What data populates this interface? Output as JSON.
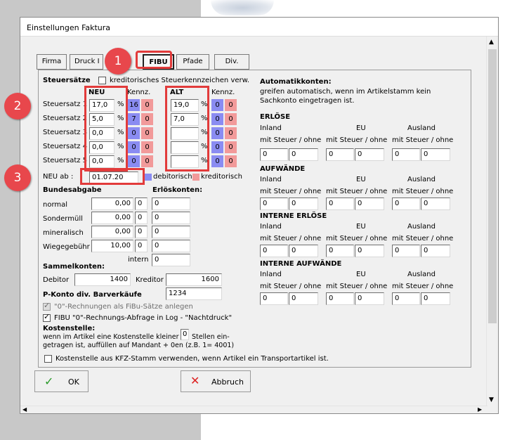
{
  "window": {
    "title": "Einstellungen Faktura"
  },
  "tabs": [
    {
      "label": "Firma",
      "active": false
    },
    {
      "label": "Druck I",
      "active": false
    },
    {
      "label": "FIBU",
      "active": true
    },
    {
      "label": "Pfade",
      "active": false
    },
    {
      "label": "Div.",
      "active": false
    }
  ],
  "annotations": {
    "badge1": "1",
    "badge2": "2",
    "badge3": "3",
    "color": "#e8474c"
  },
  "steuer": {
    "title": "Steuersätze",
    "kred_check_label": "kreditorisches Steuerkennzeichen verw.",
    "neu_header": "NEU",
    "alt_header": "ALT",
    "kennz_header": "Kennz.",
    "percent": "%",
    "rows": [
      {
        "label": "Steuersatz 1",
        "neu": "17,0",
        "neu_k1": "16",
        "neu_k2": "0",
        "alt": "19,0",
        "alt_k1": "0",
        "alt_k2": "0"
      },
      {
        "label": "Steuersatz 2",
        "neu": "5,0",
        "neu_k1": "7",
        "neu_k2": "0",
        "alt": "7,0",
        "alt_k1": "0",
        "alt_k2": "0"
      },
      {
        "label": "Steuersatz 3",
        "neu": "0,0",
        "neu_k1": "0",
        "neu_k2": "0",
        "alt": "",
        "alt_k1": "0",
        "alt_k2": "0"
      },
      {
        "label": "Steuersatz 4",
        "neu": "0,0",
        "neu_k1": "0",
        "neu_k2": "0",
        "alt": "",
        "alt_k1": "0",
        "alt_k2": "0"
      },
      {
        "label": "Steuersatz 5",
        "neu": "0,0",
        "neu_k1": "0",
        "neu_k2": "0",
        "alt": "",
        "alt_k1": "0",
        "alt_k2": "0"
      }
    ],
    "neu_ab_label": "NEU ab :",
    "neu_ab_value": "01.07.20",
    "legend_deb": "debitorisch",
    "legend_kred": "kreditorisch",
    "color_deb": "#8a8cf2",
    "color_kred": "#f29a9a"
  },
  "bundes": {
    "title": "Bundesabgabe",
    "erloes_title": "Erlöskonten:",
    "rows": [
      {
        "label": "normal",
        "value": "0,00",
        "k": "0",
        "konto": "0"
      },
      {
        "label": "Sondermüll",
        "value": "0,00",
        "k": "0",
        "konto": "0"
      },
      {
        "label": "mineralisch",
        "value": "0,00",
        "k": "0",
        "konto": "0"
      },
      {
        "label": "Wiegegebühr",
        "value": "10,00",
        "k": "0",
        "konto": "0"
      }
    ],
    "intern_label": "intern",
    "intern_value": "0"
  },
  "sammel": {
    "title": "Sammelkonten:",
    "debitor_label": "Debitor",
    "debitor_value": "1400",
    "kreditor_label": "Kreditor",
    "kreditor_value": "1600"
  },
  "pkonto": {
    "label": "P-Konto div. Barverkäufe",
    "value": "1234"
  },
  "checks": {
    "null_rech": "\"0\"-Rechnungen als FiBu-Sätze anlegen",
    "fibu_null": "FIBU \"0\"-Rechnungs-Abfrage in Log - \"Nachtdruck\"",
    "fibu_null_checked": true
  },
  "kst": {
    "title": "Kostenstelle:",
    "text1": "wenn im Artikel eine Kostenstelle kleiner",
    "value": "0",
    "text2": "Stellen ein-",
    "text3": "getragen ist, auffüllen auf Mandant + 0en (z.B. 1= 4001)",
    "kfz_label": "Kostenstelle aus KFZ-Stamm verwenden, wenn Artikel ein Transportartikel ist."
  },
  "auto": {
    "title": "Automatikkonten:",
    "desc1": "greifen automatisch, wenn im Artikelstamm kein",
    "desc2": "Sachkonto eingetragen ist.",
    "col_inland": "Inland",
    "col_eu": "EU",
    "col_ausland": "Ausland",
    "sub": "mit Steuer / ohne",
    "sections": [
      {
        "title": "ERLÖSE",
        "values": [
          "0",
          "0",
          "0",
          "0",
          "0",
          "0"
        ]
      },
      {
        "title": "AUFWÄNDE",
        "values": [
          "0",
          "0",
          "0",
          "0",
          "0",
          "0"
        ]
      },
      {
        "title": "INTERNE ERLÖSE",
        "values": [
          "0",
          "0",
          "0",
          "0",
          "0",
          "0"
        ]
      },
      {
        "title": "INTERNE AUFWÄNDE",
        "values": [
          "0",
          "0",
          "0",
          "0",
          "0",
          "0"
        ]
      }
    ]
  },
  "buttons": {
    "ok": "OK",
    "abbruch": "Abbruch",
    "ok_icon": "checkmark-icon",
    "abbruch_icon": "x-icon"
  }
}
